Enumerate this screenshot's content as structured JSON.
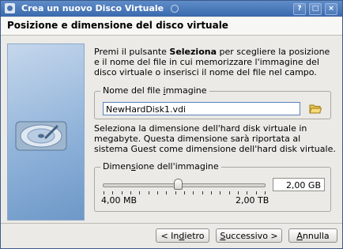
{
  "window": {
    "title": "Crea un nuovo Disco Virtuale",
    "buttons": {
      "help": "?",
      "maximize": "□",
      "close": "×"
    }
  },
  "header": {
    "title": "Posizione e dimensione del disco virtuale"
  },
  "intro": {
    "prefix": "Premi il pulsante ",
    "bold": "Seleziona",
    "suffix": " per scegliere la posizione e il nome del file in cui memorizzare l'immagine del disco virtuale o inserisci il nome del file nel campo."
  },
  "file_group": {
    "legend_pre": "Nome del file ",
    "legend_accel": "i",
    "legend_post": "mmagine",
    "value": "NewHardDisk1.vdi",
    "browse_icon": "folder-open-icon"
  },
  "size_intro": "Seleziona la dimensione dell'hard disk virtuale in megabyte. Questa dimensione sarà riportata al sistema Guest come dimensione dell'hard disk virtuale.",
  "size_group": {
    "legend_pre": "Dimen",
    "legend_accel": "s",
    "legend_post": "ione dell'immagine",
    "value": "2,00 GB",
    "min_label": "4,00 MB",
    "max_label": "2,00 TB",
    "slider_position": 0.46,
    "tick_count": 19
  },
  "footer": {
    "back": {
      "pre": "< In",
      "accel": "d",
      "post": "ietro"
    },
    "next": {
      "pre": "",
      "accel": "S",
      "post": "uccessivo >"
    },
    "cancel": {
      "pre": "",
      "accel": "A",
      "post": "nnulla"
    }
  },
  "colors": {
    "titlebar": "#3a6aad",
    "field_border": "#5a82bd",
    "window_bg": "#ebeae6"
  }
}
